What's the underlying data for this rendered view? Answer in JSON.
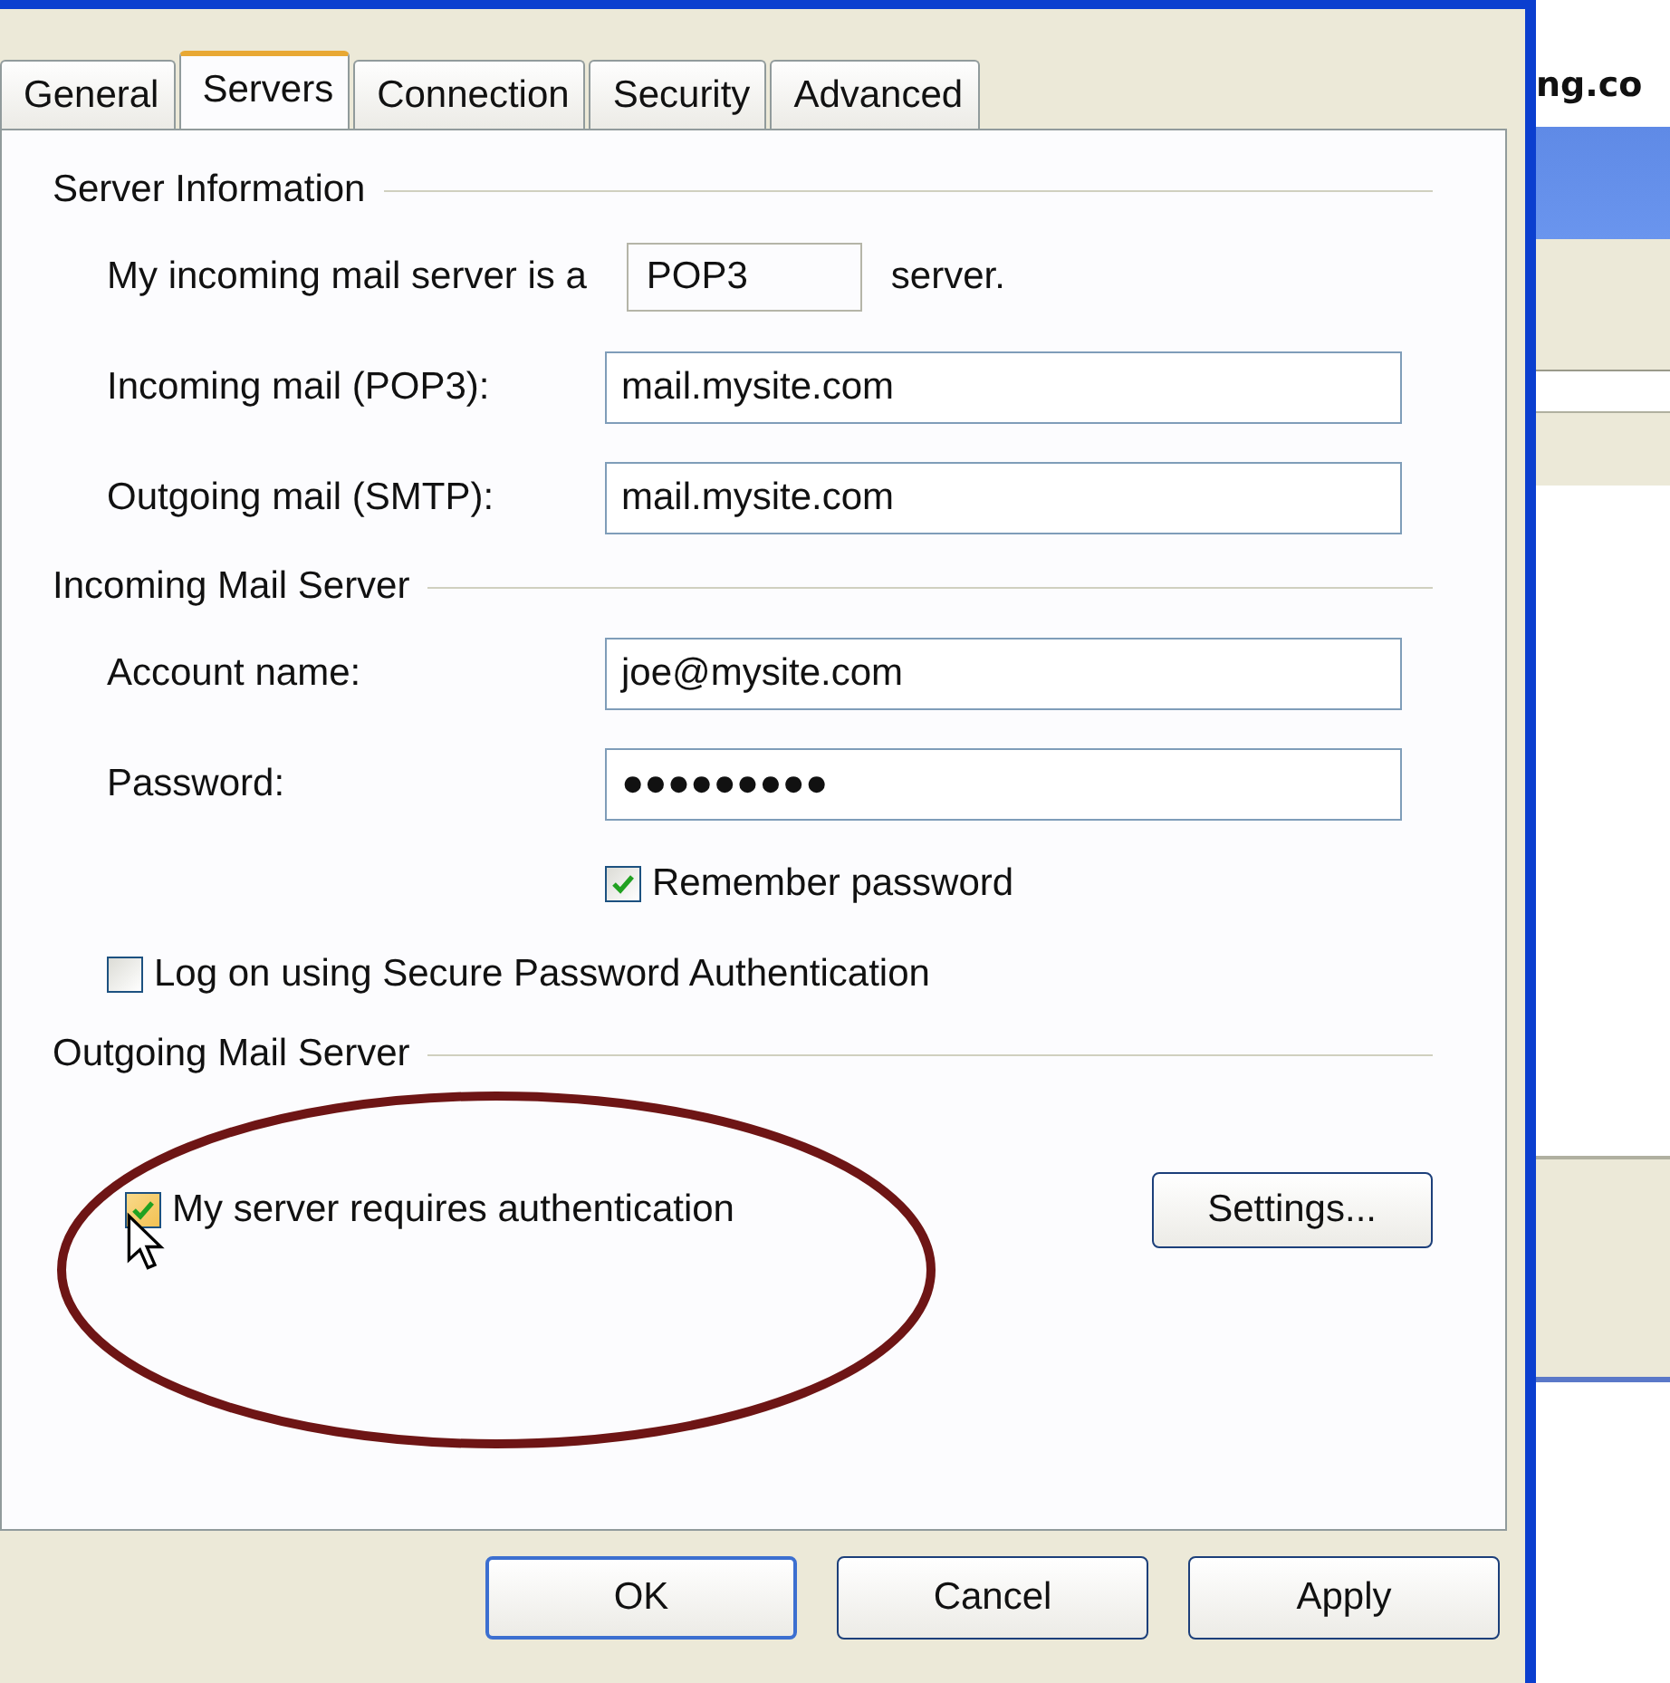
{
  "tabs": [
    {
      "label": "General",
      "selected": false
    },
    {
      "label": "Servers",
      "selected": true
    },
    {
      "label": "Connection",
      "selected": false
    },
    {
      "label": "Security",
      "selected": false
    },
    {
      "label": "Advanced",
      "selected": false
    }
  ],
  "server_information": {
    "title": "Server Information",
    "server_type_prefix": "My incoming mail server is a",
    "server_type": "POP3",
    "server_type_suffix": "server.",
    "fields": [
      {
        "label": "Incoming mail (POP3):",
        "value": "mail.mysite.com"
      },
      {
        "label": "Outgoing mail (SMTP):",
        "value": "mail.mysite.com"
      }
    ]
  },
  "incoming_mail_server": {
    "title": "Incoming Mail Server",
    "fields": [
      {
        "label": "Account name:",
        "value": "joe@mysite.com"
      },
      {
        "label": "Password:",
        "value": "●●●●●●●●●"
      }
    ],
    "checkboxes": [
      {
        "label": "Remember password",
        "checked": true,
        "kind": "indented"
      },
      {
        "label": "Log on using Secure Password Authentication",
        "checked": false,
        "kind": "plain"
      }
    ]
  },
  "outgoing_mail_server": {
    "title": "Outgoing Mail Server",
    "checkbox": {
      "label": "My server requires authentication",
      "checked": true
    },
    "button": "Settings..."
  },
  "buttons": [
    "OK",
    "Cancel",
    "Apply"
  ],
  "background_window": {
    "title_fragment": "ng.co"
  }
}
